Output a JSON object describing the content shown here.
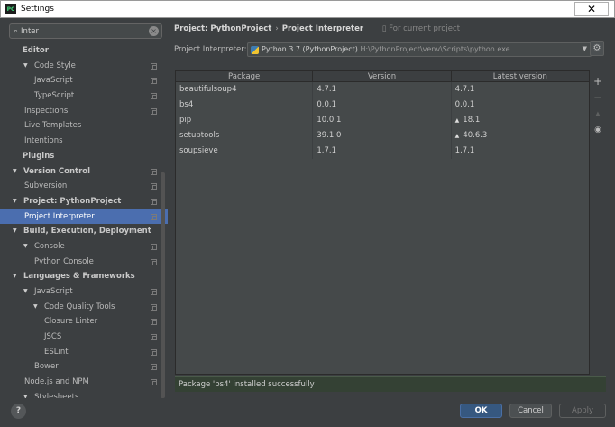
{
  "window": {
    "title": "Settings",
    "app_icon": "PC",
    "close_glyph": "✕"
  },
  "search": {
    "value": "Inter",
    "icon": "search-icon",
    "clear_glyph": "×"
  },
  "tree": [
    {
      "label": "Editor",
      "level": 0,
      "bold": true,
      "arrow": false,
      "copy": false
    },
    {
      "label": "Code Style",
      "level": 1,
      "bold": false,
      "arrow": true,
      "copy": true
    },
    {
      "label": "JavaScript",
      "level": 2,
      "bold": false,
      "arrow": false,
      "copy": true
    },
    {
      "label": "TypeScript",
      "level": 2,
      "bold": false,
      "arrow": false,
      "copy": true
    },
    {
      "label": "Inspections",
      "level": 1,
      "bold": false,
      "arrow": false,
      "copy": true
    },
    {
      "label": "Live Templates",
      "level": 1,
      "bold": false,
      "arrow": false,
      "copy": false
    },
    {
      "label": "Intentions",
      "level": 1,
      "bold": false,
      "arrow": false,
      "copy": false
    },
    {
      "label": "Plugins",
      "level": 0,
      "bold": true,
      "arrow": false,
      "copy": false
    },
    {
      "label": "Version Control",
      "level": 0,
      "bold": true,
      "arrow": true,
      "copy": true
    },
    {
      "label": "Subversion",
      "level": 1,
      "bold": false,
      "arrow": false,
      "copy": true
    },
    {
      "label": "Project: PythonProject",
      "level": 0,
      "bold": true,
      "arrow": true,
      "copy": true
    },
    {
      "label": "Project Interpreter",
      "level": 1,
      "bold": false,
      "arrow": false,
      "copy": true,
      "selected": true
    },
    {
      "label": "Build, Execution, Deployment",
      "level": 0,
      "bold": true,
      "arrow": true,
      "copy": false
    },
    {
      "label": "Console",
      "level": 1,
      "bold": false,
      "arrow": true,
      "copy": true
    },
    {
      "label": "Python Console",
      "level": 2,
      "bold": false,
      "arrow": false,
      "copy": true
    },
    {
      "label": "Languages & Frameworks",
      "level": 0,
      "bold": true,
      "arrow": true,
      "copy": false
    },
    {
      "label": "JavaScript",
      "level": 1,
      "bold": false,
      "arrow": true,
      "copy": true
    },
    {
      "label": "Code Quality Tools",
      "level": 2,
      "bold": false,
      "arrow": true,
      "copy": true
    },
    {
      "label": "Closure Linter",
      "level": 3,
      "bold": false,
      "arrow": false,
      "copy": true
    },
    {
      "label": "JSCS",
      "level": 3,
      "bold": false,
      "arrow": false,
      "copy": true
    },
    {
      "label": "ESLint",
      "level": 3,
      "bold": false,
      "arrow": false,
      "copy": true
    },
    {
      "label": "Bower",
      "level": 2,
      "bold": false,
      "arrow": false,
      "copy": true
    },
    {
      "label": "Node.js and NPM",
      "level": 1,
      "bold": false,
      "arrow": false,
      "copy": true
    },
    {
      "label": "Stylesheets",
      "level": 1,
      "bold": false,
      "arrow": true,
      "copy": false
    }
  ],
  "breadcrumb": {
    "project": "Project: PythonProject",
    "separator": "›",
    "page": "Project Interpreter",
    "scope": "For current project"
  },
  "interpreter": {
    "label": "Project Interpreter:",
    "name": "Python 3.7 (PythonProject)",
    "path": "H:\\PythonProject\\venv\\Scripts\\python.exe",
    "dropdown_glyph": "▼",
    "gear_glyph": "⚙"
  },
  "table": {
    "headers": [
      "Package",
      "Version",
      "Latest version"
    ],
    "rows": [
      {
        "package": "beautifulsoup4",
        "version": "4.7.1",
        "latest": "4.7.1",
        "upgrade": ""
      },
      {
        "package": "bs4",
        "version": "0.0.1",
        "latest": "0.0.1",
        "upgrade": ""
      },
      {
        "package": "pip",
        "version": "10.0.1",
        "latest": "18.1",
        "upgrade": "▲"
      },
      {
        "package": "setuptools",
        "version": "39.1.0",
        "latest": "40.6.3",
        "upgrade": "▲"
      },
      {
        "package": "soupsieve",
        "version": "1.7.1",
        "latest": "1.7.1",
        "upgrade": ""
      }
    ]
  },
  "tools": {
    "add": "+",
    "remove": "−",
    "up": "▲",
    "eye": "◉"
  },
  "status": {
    "message": "Package 'bs4' installed successfully"
  },
  "buttons": {
    "help": "?",
    "ok": "OK",
    "cancel": "Cancel",
    "apply": "Apply"
  },
  "colors": {
    "background": "#3c3f41",
    "selection": "#4b6eaf",
    "status_bg": "#344134",
    "ok_button": "#365880"
  }
}
